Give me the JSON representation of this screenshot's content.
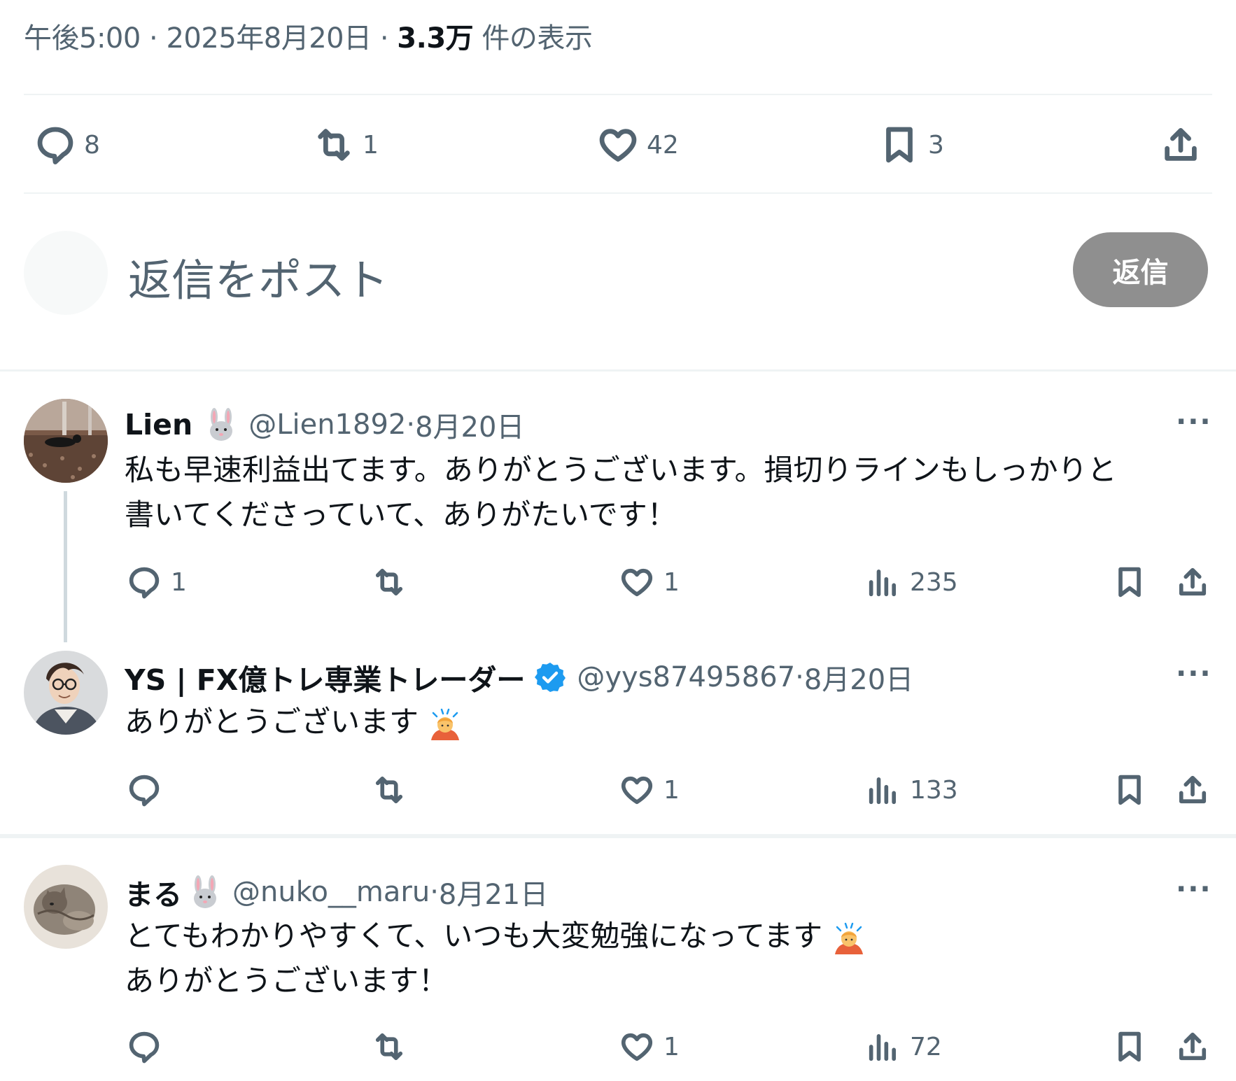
{
  "post": {
    "time": "午後5:00",
    "date": "2025年8月20日",
    "views_count": "3.3万",
    "views_label": "件の表示",
    "stats": {
      "replies": "8",
      "reposts": "1",
      "likes": "42",
      "bookmarks": "3"
    }
  },
  "composer": {
    "placeholder": "返信をポスト",
    "button_label": "返信"
  },
  "replies": [
    {
      "name": "Lien",
      "handle": "@Lien1892",
      "date": "8月20日",
      "line1": "私も早速利益出てます。ありがとうございます。損切りラインもしっかりと",
      "line2": "書いてくださっていて、ありがたいです！",
      "replies": "1",
      "reposts": "",
      "likes": "1",
      "views": "235"
    },
    {
      "name": "YS | FX億トレ専業トレーダー",
      "handle": "@yys87495867",
      "date": "8月20日",
      "line1": "ありがとうございます",
      "replies": "",
      "reposts": "",
      "likes": "1",
      "views": "133"
    },
    {
      "name": "まる",
      "handle": "@nuko__maru",
      "date": "8月21日",
      "line1": "とてもわかりやすくて、いつも大変勉強になってます",
      "line2": "ありがとうございます！",
      "replies": "",
      "reposts": "",
      "likes": "1",
      "views": "72"
    }
  ],
  "separator": " · ",
  "more_label": "···",
  "colors": {
    "text_primary": "#0f1419",
    "text_secondary": "#536471",
    "divider": "#eff3f4",
    "verified": "#1d9bf0",
    "reply_button_bg": "#8f8f8f"
  }
}
